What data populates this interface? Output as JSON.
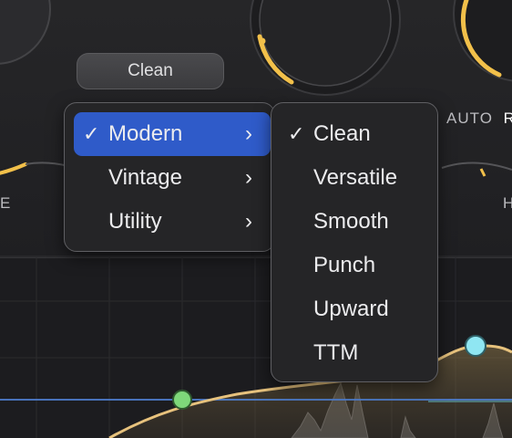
{
  "mode_button": {
    "label": "Clean"
  },
  "knob_labels": {
    "auto": "AUTO",
    "auto_suffix": "R",
    "left_edge": "E",
    "right_edge": "H"
  },
  "primary_menu": {
    "items": [
      {
        "label": "Modern",
        "checked": true,
        "highlighted": true,
        "check_glyph": "✓",
        "chevron": "›"
      },
      {
        "label": "Vintage",
        "checked": false,
        "highlighted": false,
        "check_glyph": "",
        "chevron": "›"
      },
      {
        "label": "Utility",
        "checked": false,
        "highlighted": false,
        "check_glyph": "",
        "chevron": "›"
      }
    ]
  },
  "submenu": {
    "items": [
      {
        "label": "Clean",
        "checked": true,
        "check_glyph": "✓"
      },
      {
        "label": "Versatile",
        "checked": false,
        "check_glyph": ""
      },
      {
        "label": "Smooth",
        "checked": false,
        "check_glyph": ""
      },
      {
        "label": "Punch",
        "checked": false,
        "check_glyph": ""
      },
      {
        "label": "Upward",
        "checked": false,
        "check_glyph": ""
      },
      {
        "label": "TTM",
        "checked": false,
        "check_glyph": ""
      }
    ]
  },
  "colors": {
    "accent_yellow": "#f2c04a",
    "highlight_blue": "#2f5bc9",
    "node_green": "#7ed87a",
    "node_cyan": "#8fe6f2",
    "eq_curve": "#e7c27d",
    "flat_line": "#4f7fd0"
  }
}
